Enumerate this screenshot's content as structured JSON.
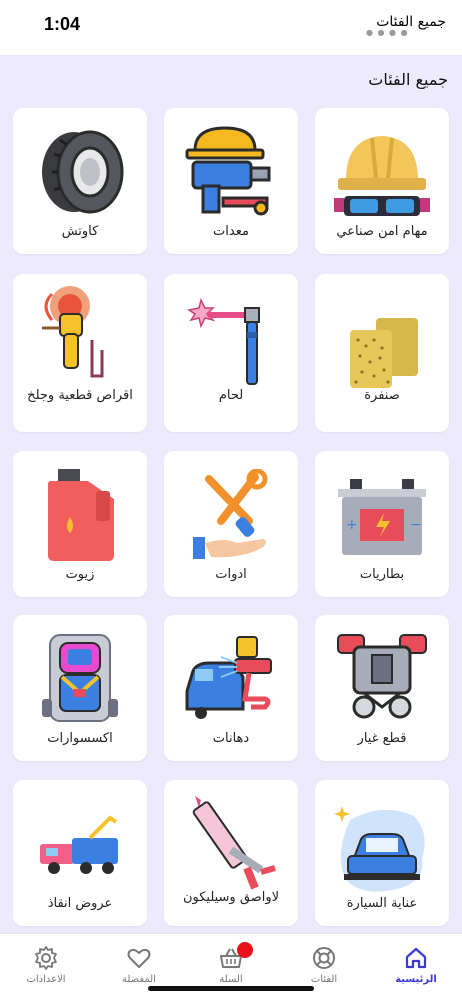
{
  "status_bar": {
    "time": "1:04",
    "carrier": "جميع الفئات"
  },
  "page": {
    "section_title": "جميع الفئات"
  },
  "categories": [
    {
      "label": "مهام امن صناعي",
      "icon": "safety-helmet-goggles-icon"
    },
    {
      "label": "معدات",
      "icon": "drill-tools-icon"
    },
    {
      "label": "كاوتش",
      "icon": "tire-icon"
    },
    {
      "label": "صنفرة",
      "icon": "sandpaper-icon"
    },
    {
      "label": "لحام",
      "icon": "welding-torch-icon"
    },
    {
      "label": "اقراص قطعية وجلخ",
      "icon": "angle-grinder-icon"
    },
    {
      "label": "بطاريات",
      "icon": "car-battery-icon"
    },
    {
      "label": "ادوات",
      "icon": "wrench-screwdriver-icon"
    },
    {
      "label": "زيوت",
      "icon": "oil-can-icon"
    },
    {
      "label": "قطع غيار",
      "icon": "engine-parts-icon"
    },
    {
      "label": "دهانات",
      "icon": "spray-paint-car-icon"
    },
    {
      "label": "اكسسوارات",
      "icon": "car-seat-icon"
    },
    {
      "label": "عناية السيارة",
      "icon": "car-care-icon"
    },
    {
      "label": "لاواصق وسيليكون",
      "icon": "silicone-gun-icon"
    },
    {
      "label": "عروض انقاذ",
      "icon": "tow-truck-icon"
    }
  ],
  "bottom_nav": {
    "home": "الرئيسية",
    "categories": "الفئات",
    "cart": "السلة",
    "favorites": "المفضلة",
    "settings": "الاعدادات"
  },
  "colors": {
    "accent": "#3b3bd4",
    "background": "#eceafc",
    "badge": "#e8101b"
  }
}
